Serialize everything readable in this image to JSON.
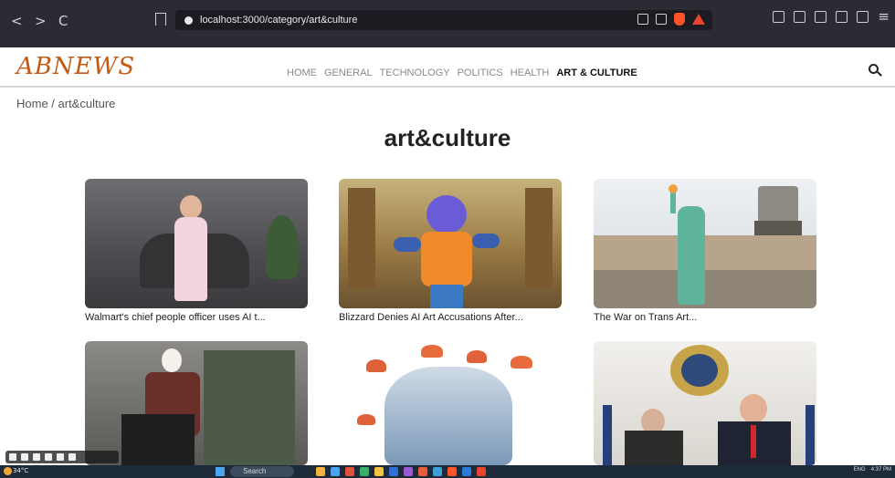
{
  "browser": {
    "url": "localhost:3000/category/art&culture",
    "back": "<",
    "forward": ">",
    "reload": "C",
    "menu": "≡"
  },
  "site": {
    "logo": "ABNEWS",
    "nav": [
      "HOME",
      "GENERAL",
      "TECHNOLOGY",
      "POLITICS",
      "HEALTH",
      "ART & CULTURE"
    ],
    "active_nav": "ART & CULTURE"
  },
  "breadcrumb": "Home / art&culture",
  "page_title": "art&culture",
  "cards": [
    {
      "caption": "Walmart's chief people officer uses AI t..."
    },
    {
      "caption": "Blizzard Denies AI Art Accusations After..."
    },
    {
      "caption": "The War on Trans Art..."
    },
    {
      "caption": ""
    },
    {
      "caption": ""
    },
    {
      "caption": ""
    }
  ],
  "taskbar": {
    "weather": "34°C",
    "search": "Search",
    "lang": "ENG",
    "time": "4:37 PM"
  },
  "colors": {
    "logo": "#c25a13",
    "browser_chrome": "#2b2b33",
    "taskbar": "#1d2a3a"
  }
}
